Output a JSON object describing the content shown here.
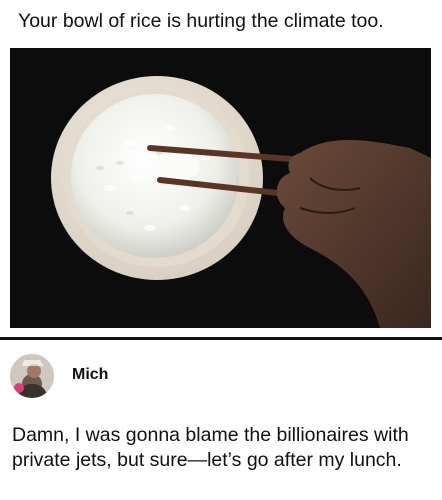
{
  "post": {
    "headline": "Your bowl of rice is hurting the climate too.",
    "image_icon": "rice-bowl-with-chopsticks-photo"
  },
  "reply": {
    "author": "Mich",
    "avatar_icon": "user-avatar",
    "text": "Damn, I was gonna blame the billionaires with private jets, but sure—let’s go after my lunch."
  },
  "colors": {
    "photo_background": "#0c0c0c",
    "divider": "#111111",
    "text": "#111111"
  }
}
